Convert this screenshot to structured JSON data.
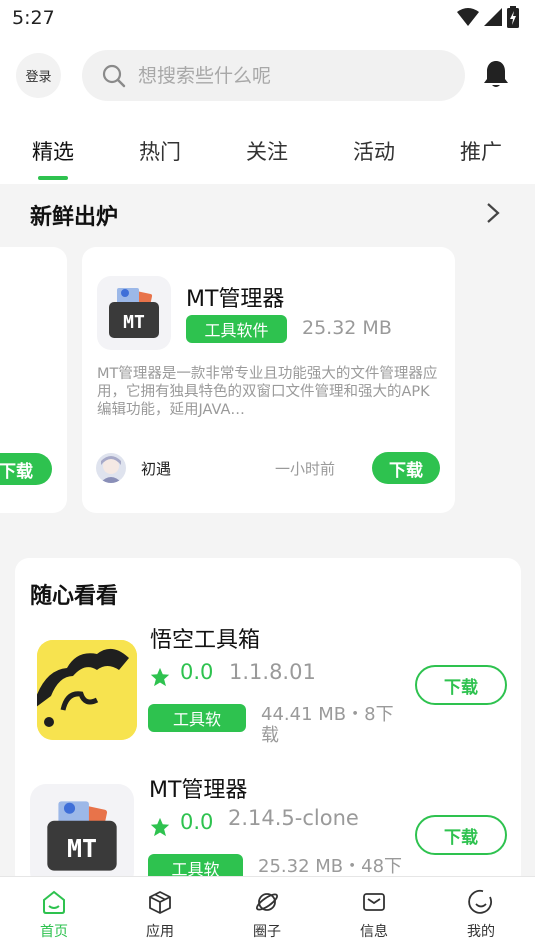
{
  "status_bar": {
    "time": "5:27"
  },
  "header": {
    "login_label": "登录",
    "search_placeholder": "想搜索些什么呢"
  },
  "tabs": [
    {
      "label": "精选"
    },
    {
      "label": "热门"
    },
    {
      "label": "关注"
    },
    {
      "label": "活动"
    },
    {
      "label": "推广"
    }
  ],
  "fresh": {
    "title": "新鲜出炉",
    "prev_card": {
      "download_label": "下载"
    },
    "card": {
      "name": "MT管理器",
      "tag": "工具软件",
      "size": "25.32 MB",
      "description": "MT管理器是一款非常专业且功能强大的文件管理器应用，它拥有独具特色的双窗口文件管理和强大的APK编辑功能，延用JAVA…",
      "author": "初遇",
      "time": "一小时前",
      "download_label": "下载"
    }
  },
  "random": {
    "title": "随心看看",
    "items": [
      {
        "name": "悟空工具箱",
        "rating": "0.0",
        "version": "1.1.8.01",
        "tag": "工具软",
        "size_line1": "44.41 MB・8下",
        "size_line2": "载",
        "download_label": "下载"
      },
      {
        "name": "MT管理器",
        "rating": "0.0",
        "version": "2.14.5-clone",
        "tag": "工具软",
        "size_line1": "25.32 MB・48下",
        "download_label": "下载"
      }
    ]
  },
  "bottom_nav": [
    {
      "label": "首页",
      "icon": "home-icon"
    },
    {
      "label": "应用",
      "icon": "box-icon"
    },
    {
      "label": "圈子",
      "icon": "planet-icon"
    },
    {
      "label": "信息",
      "icon": "mail-icon"
    },
    {
      "label": "我的",
      "icon": "smile-icon"
    }
  ],
  "colors": {
    "accent": "#2ec24f",
    "background_gray": "#f4f4f4",
    "muted_text": "#9a9a9a"
  }
}
